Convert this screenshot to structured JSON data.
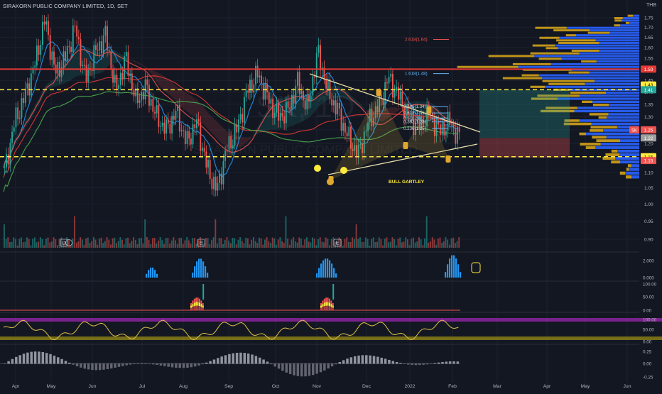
{
  "header": {
    "title": "SIRAKORN PUBLIC COMPANY LIMITED, 1D, SET",
    "currency": "THB",
    "watermark_symbol": "SK, 1D",
    "watermark_name": "SIRAKORN PUBLIC COMPANY LIMITED"
  },
  "colors": {
    "background": "#131722",
    "up": "#26a69a",
    "down": "#ef5350",
    "resistance": "#e53935",
    "support": "#ffeb3b",
    "pattern": "#c8a23a",
    "volume_profile_up": "#2962ff",
    "volume_profile_down": "#c89b1a"
  },
  "chart_data": {
    "type": "line",
    "title": "SIRAKORN PUBLIC COMPANY LIMITED, 1D, SET",
    "x_axis": {
      "tick_labels": [
        "Apr",
        "May",
        "Jun",
        "Jul",
        "Aug",
        "Sep",
        "Oct",
        "Nov",
        "Dec",
        "2022",
        "Feb",
        "Mar",
        "Apr",
        "May",
        "Jun"
      ]
    },
    "y_axis": {
      "unit": "THB",
      "scale": "log",
      "tick_labels": [
        "0.90",
        "0.95",
        "1.00",
        "1.05",
        "1.10",
        "1.15",
        "1.20",
        "1.25",
        "1.30",
        "1.35",
        "1.40",
        "1.45",
        "1.50",
        "1.55",
        "1.60",
        "1.65",
        "1.70",
        "1.75"
      ],
      "ylim": [
        0.88,
        1.78
      ]
    },
    "series": [
      {
        "name": "",
        "values_approx": [
          1.1,
          1.28,
          1.38,
          1.52,
          1.74,
          1.48,
          1.55,
          1.7,
          1.45,
          1.58,
          1.66,
          1.4,
          1.55,
          1.36,
          1.42,
          1.3,
          1.25,
          1.32,
          1.2,
          1.28,
          1.12,
          1.04,
          1.18,
          1.25,
          1.4,
          1.48,
          1.38,
          1.3,
          1.32,
          1.44,
          1.33,
          1.58,
          1.4,
          1.32,
          1.22,
          1.16,
          1.28,
          1.34,
          1.46,
          1.38,
          1.3,
          1.26,
          1.32,
          1.24,
          1.28,
          1.22
        ]
      }
    ],
    "price_labels": [
      {
        "text": "1.50",
        "value": 1.5,
        "color": "#e53935"
      },
      {
        "text": "1.43",
        "value": 1.43,
        "color": "#ffeb3b"
      },
      {
        "text": "1.41",
        "value": 1.41,
        "color": "#26a69a"
      },
      {
        "text": "1.25",
        "value": 1.25,
        "color": "#ef5350"
      },
      {
        "text": "1.22",
        "value": 1.22,
        "color": "#9e9e9e"
      },
      {
        "text": "1.15",
        "value": 1.153,
        "color": "#ffeb3b"
      },
      {
        "text": "1.15",
        "value": 1.14,
        "color": "#ef5350"
      }
    ],
    "current_symbol_tag": "SK",
    "horizontal_lines": [
      {
        "value": 1.5,
        "style": "solid",
        "color": "#e53935"
      },
      {
        "value": 1.41,
        "style": "dashed",
        "color": "#ffeb3b"
      },
      {
        "value": 1.153,
        "style": "dashed",
        "color": "#ffeb3b"
      }
    ],
    "fibonacci_labels": [
      {
        "text": "2.618(1.64)",
        "value": 1.64
      },
      {
        "text": "1.618(1.48)",
        "value": 1.48
      },
      {
        "text": "0.786(1.34)",
        "value": 1.34
      },
      {
        "text": "0.618(1.31)",
        "value": 1.315
      },
      {
        "text": "0.5(1.29)",
        "value": 1.295
      },
      {
        "text": "0.382(1.28)",
        "value": 1.28
      },
      {
        "text": "0.236(1.25)",
        "value": 1.255
      }
    ],
    "annotations": [
      {
        "text": "BULL GARTLEY"
      }
    ],
    "indicator_panels": [
      {
        "name": "volume-histogram-panel",
        "tick_labels": [
          "2.000",
          "0.000"
        ]
      },
      {
        "name": "oscillator-100-panel",
        "tick_labels": [
          "100.00",
          "50.00",
          "0.00"
        ]
      },
      {
        "name": "oscillator-stoch-panel",
        "tick_labels": [
          "100.00",
          "50.00",
          "0.00"
        ]
      },
      {
        "name": "macd-panel",
        "tick_labels": [
          "0.25",
          "0.00",
          "-0.25"
        ]
      }
    ],
    "event_markers": [
      "D",
      "E",
      "E"
    ],
    "grid": true,
    "legend": "none"
  }
}
